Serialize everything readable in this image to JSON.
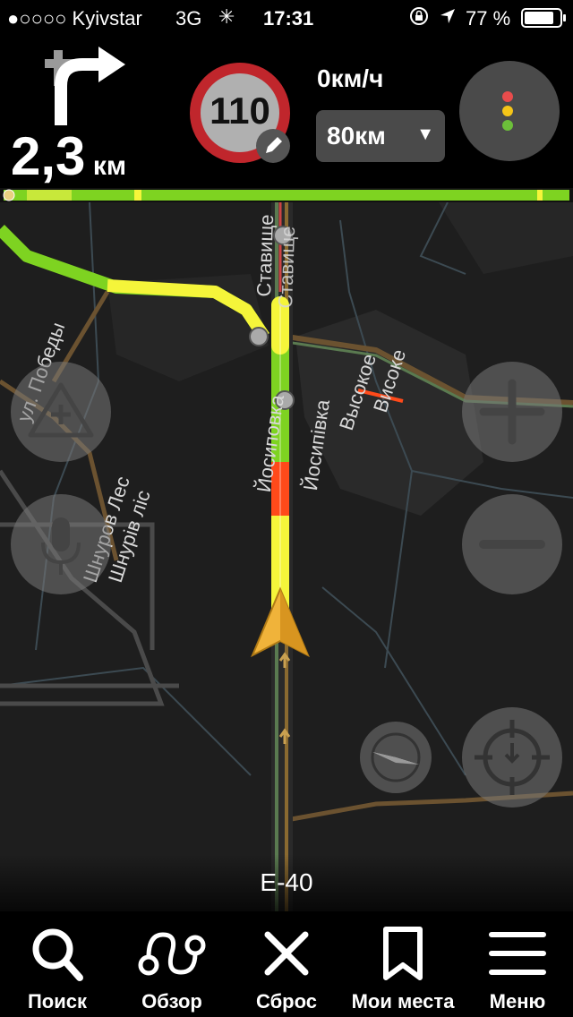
{
  "status": {
    "carrier": "●○○○○ Kyivstar",
    "network": "3G",
    "time": "17:31",
    "battery": "77 %"
  },
  "maneuver": {
    "distance": "2,3",
    "unit": "км"
  },
  "speed_limit": {
    "value": "110"
  },
  "current_speed": "0км/ч",
  "alert_distance": {
    "value": "80км",
    "chevron": "▼"
  },
  "route_progress": 0.01,
  "map": {
    "road_name": "E-40",
    "labels": {
      "pobedy": "ул. Победы",
      "shnurov_ru": "Шнуров Лес",
      "shnurov_ua": "Шнурів ліс",
      "yosipovka_ru": "Йосиповка",
      "yosipivka_ua": "Йосипівка",
      "vysokoe_ru": "Высокое",
      "vysoke_ua": "Високе",
      "stavishche_ru": "Ставище",
      "stavishche_ua": "Ставище"
    }
  },
  "nav": {
    "search": "Поиск",
    "overview": "Обзор",
    "reset": "Сброс",
    "my_places": "Мои места",
    "menu": "Меню"
  },
  "colors": {
    "route_green": "#7ed321",
    "route_yellow": "#f5f53a",
    "route_red": "#ff4a1a",
    "speed_limit_ring": "#c0262c",
    "cursor": "#f0b33a"
  }
}
